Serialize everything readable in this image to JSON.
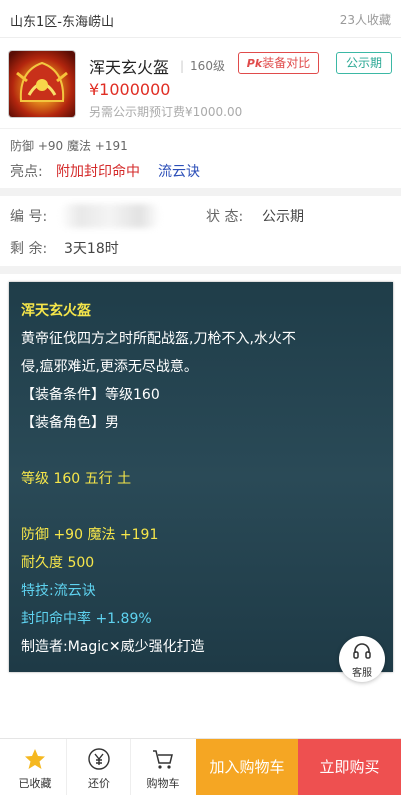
{
  "header": {
    "server": "山东1区-东海崂山",
    "favorites": "23人收藏"
  },
  "item": {
    "name": "浑天玄火盔",
    "level": "160级",
    "compare_label": "装备对比",
    "compare_badge": "Pk",
    "status_tag": "公示期",
    "price": "¥1000000",
    "deposit": "另需公示期预订费¥1000.00",
    "attrs": "防御 +90 魔法 +191",
    "highlight_label": "亮点:",
    "highlight_red": "附加封印命中",
    "highlight_blue": "流云诀"
  },
  "info": {
    "id_label": "编    号:",
    "status_label": "状  态:",
    "status_value": "公示期",
    "remaining_label": "剩  余:",
    "remaining_value": "3天18时"
  },
  "description": {
    "title": "浑天玄火盔",
    "line1": "黄帝征伐四方之时所配战盔,刀枪不入,水火不",
    "line2": "侵,瘟邪难近,更添无尽战意。",
    "line3": "【装备条件】等级160",
    "line4": "【装备角色】男",
    "line5": "等级 160  五行 土",
    "line6": "防御 +90 魔法 +191",
    "line7": "耐久度 500",
    "line8": "特技:流云诀",
    "line9": "封印命中率 +1.89%",
    "line10": "制造者:Magic✕威少强化打造"
  },
  "customer_service": "客服",
  "bottom": {
    "favorited": "已收藏",
    "bargain": "还价",
    "cart": "购物车",
    "add_cart": "加入购物车",
    "buy_now": "立即购买"
  },
  "colors": {
    "price_red": "#e02e24",
    "panel_bg": "#23424f",
    "accent_orange": "#f5a623",
    "accent_red": "#ee5050",
    "status_teal": "#2aa894"
  }
}
